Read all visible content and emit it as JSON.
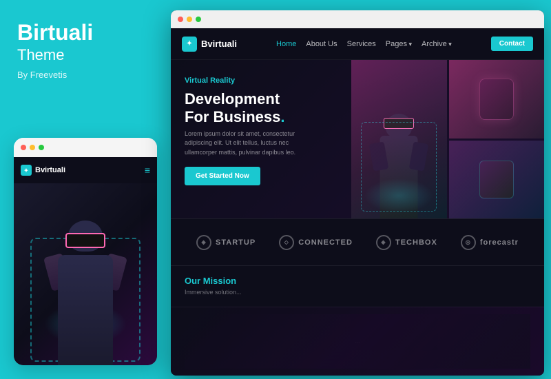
{
  "left": {
    "brand_name": "Birtuali",
    "brand_sub": "Theme",
    "brand_author": "By Freevetis"
  },
  "mobile": {
    "logo": "Bvirtuali",
    "dots": [
      "red",
      "yellow",
      "green"
    ]
  },
  "browser": {
    "dots": [
      "red",
      "yellow",
      "green"
    ]
  },
  "nav": {
    "logo": "Bvirtuali",
    "links": [
      {
        "label": "Home",
        "active": true
      },
      {
        "label": "About Us",
        "active": false
      },
      {
        "label": "Services",
        "active": false
      },
      {
        "label": "Pages",
        "active": false,
        "arrow": true
      },
      {
        "label": "Archive",
        "active": false,
        "arrow": true
      }
    ],
    "contact_btn": "Contact"
  },
  "hero": {
    "tag": "Virtual Reality",
    "title_line1": "Development",
    "title_line2": "For Business",
    "title_dot": ".",
    "desc": "Lorem ipsum dolor sit amet, consectetur adipiscing elit. Ut elit tellus, luctus nec ullamcorper mattis, pulvinar dapibus leo.",
    "cta_btn": "Get Started Now"
  },
  "brands": [
    {
      "icon": "◈",
      "name": "STARTUP"
    },
    {
      "icon": "◇",
      "name": "CONNECTED"
    },
    {
      "icon": "◈",
      "name": "TECHBOX"
    },
    {
      "icon": "◎",
      "name": "forecastr"
    }
  ],
  "mission": {
    "title": "Our Mission",
    "subtitle": "Immersive solution..."
  }
}
